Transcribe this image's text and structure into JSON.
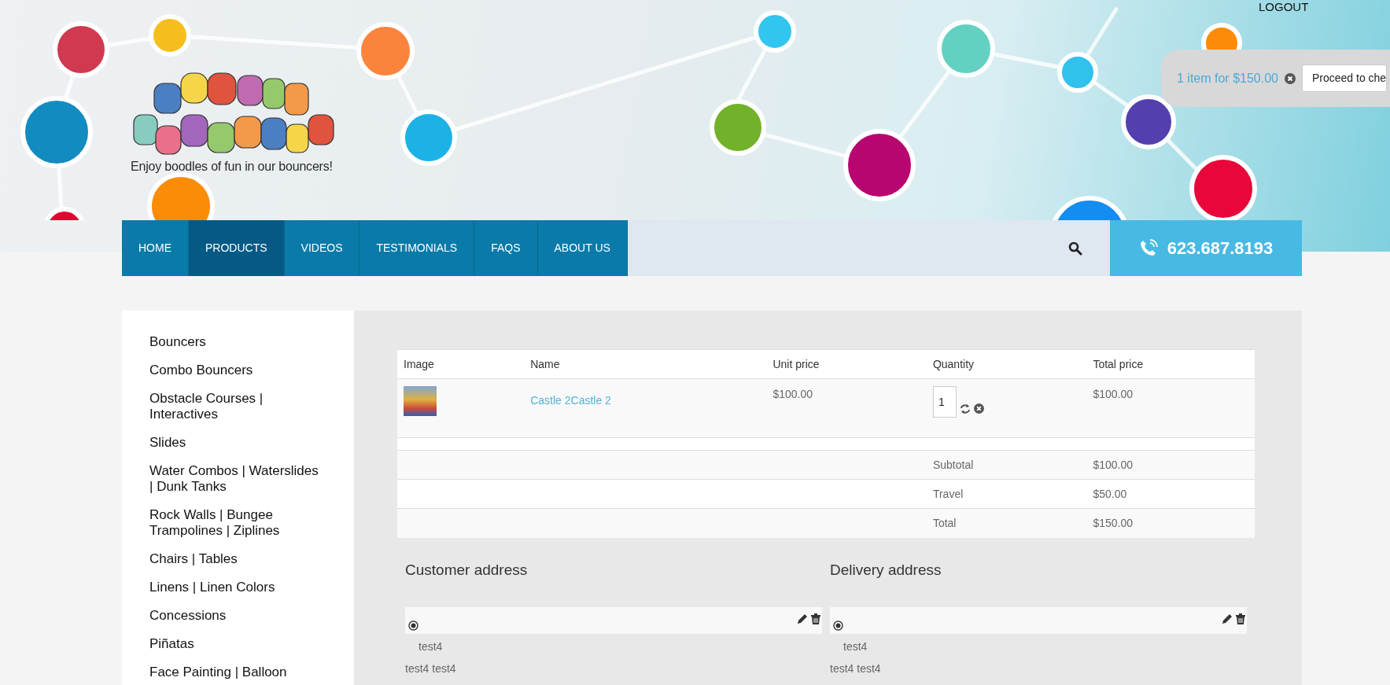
{
  "header": {
    "logout": "LOGOUT",
    "cart": {
      "summary": "1 item for $150.00",
      "checkout_button": "Proceed to che"
    },
    "tagline": "Enjoy boodles of fun in our bouncers!"
  },
  "nav": {
    "items": [
      {
        "label": "HOME",
        "selected": false
      },
      {
        "label": "PRODUCTS",
        "selected": true
      },
      {
        "label": "VIDEOS",
        "selected": false
      },
      {
        "label": "TESTIMONIALS",
        "selected": false
      },
      {
        "label": "FAQS",
        "selected": false
      },
      {
        "label": "ABOUT US",
        "selected": false
      }
    ],
    "phone": "623.687.8193"
  },
  "sidebar": {
    "items": [
      "Bouncers",
      "Combo Bouncers",
      "Obstacle Courses | Interactives",
      "Slides",
      "Water Combos | Waterslides | Dunk Tanks",
      "Rock Walls | Bungee Trampolines | Ziplines",
      "Chairs | Tables",
      "Linens | Linen Colors",
      "Concessions",
      "Piñatas",
      "Face Painting | Balloon"
    ]
  },
  "cart_table": {
    "columns": [
      "Image",
      "Name",
      "Unit price",
      "Quantity",
      "Total price"
    ],
    "rows": [
      {
        "name": "Castle 2Castle 2",
        "unit_price": "$100.00",
        "quantity": "1",
        "total_price": "$100.00"
      }
    ],
    "totals": [
      {
        "label": "Subtotal",
        "value": "$100.00"
      },
      {
        "label": "Travel",
        "value": "$50.00"
      },
      {
        "label": "Total",
        "value": "$150.00"
      }
    ]
  },
  "addresses": [
    {
      "title": "Customer address",
      "entries": [
        {
          "selected": true,
          "name": "test4",
          "line": "test4 test4"
        }
      ]
    },
    {
      "title": "Delivery address",
      "entries": [
        {
          "selected": true,
          "name": "test4",
          "line": "test4 test4"
        }
      ]
    }
  ]
}
